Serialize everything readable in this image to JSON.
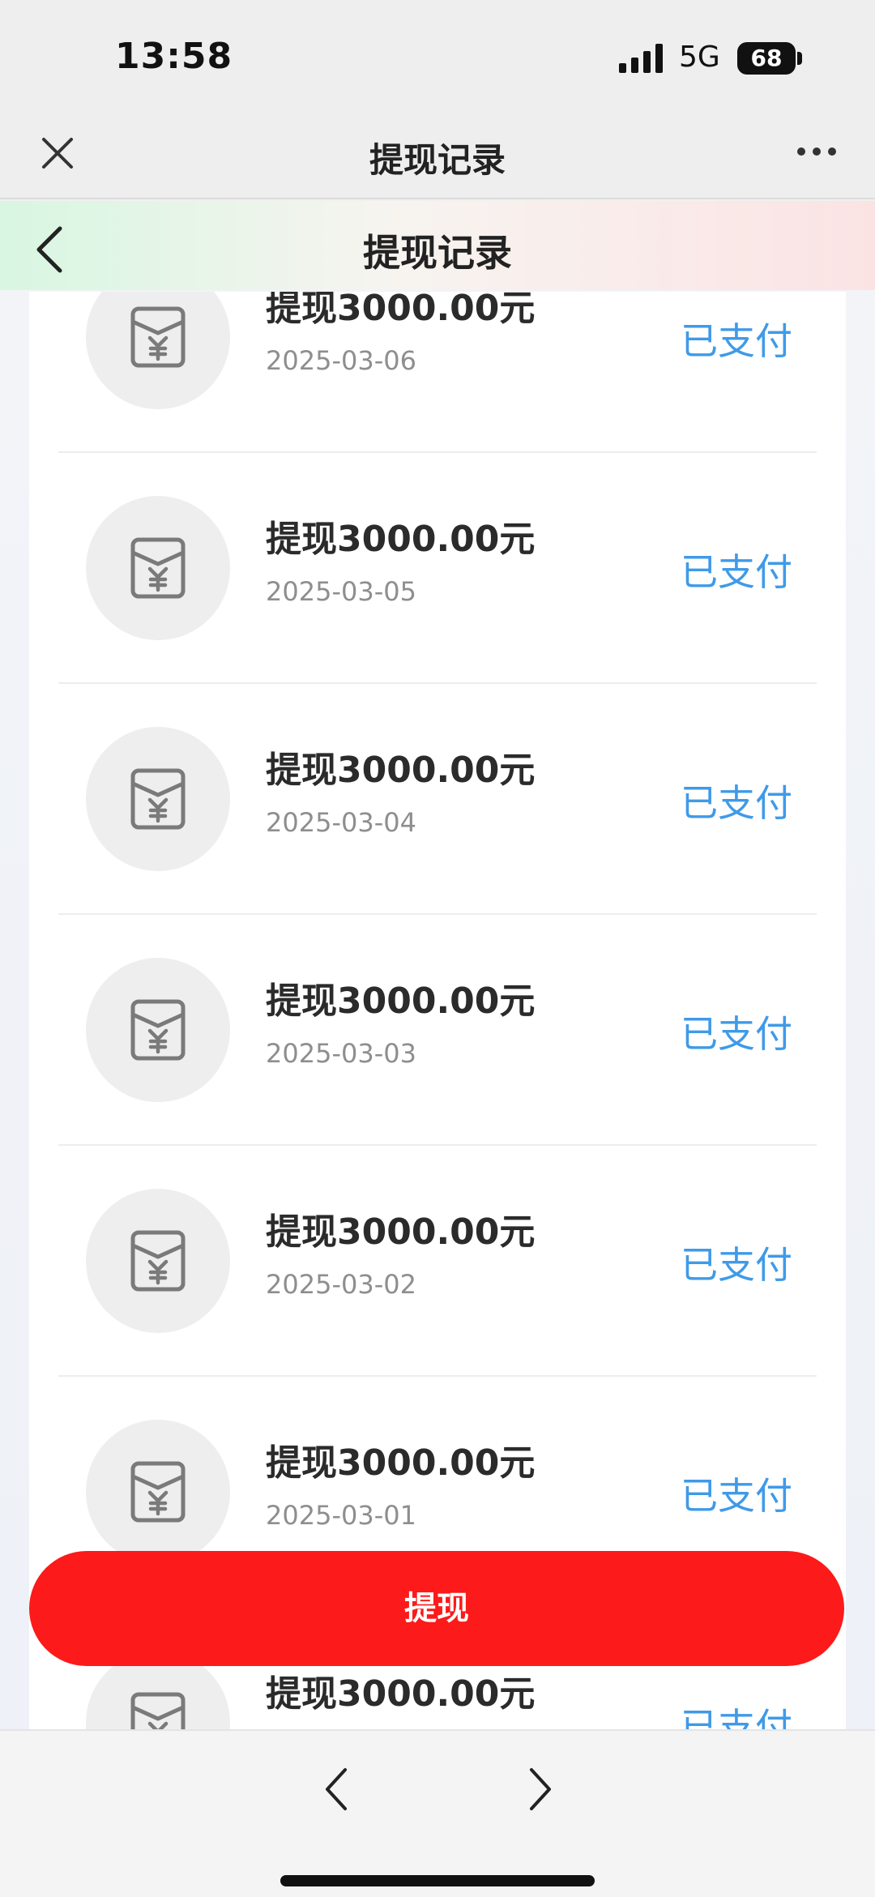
{
  "status_bar": {
    "time": "13:58",
    "network": "5G",
    "battery": "68"
  },
  "browser": {
    "title": "提现记录"
  },
  "page": {
    "title": "提现记录"
  },
  "records": [
    {
      "title": "提现3000.00元",
      "date": "2025-03-06",
      "status": "已支付"
    },
    {
      "title": "提现3000.00元",
      "date": "2025-03-05",
      "status": "已支付"
    },
    {
      "title": "提现3000.00元",
      "date": "2025-03-04",
      "status": "已支付"
    },
    {
      "title": "提现3000.00元",
      "date": "2025-03-03",
      "status": "已支付"
    },
    {
      "title": "提现3000.00元",
      "date": "2025-03-02",
      "status": "已支付"
    },
    {
      "title": "提现3000.00元",
      "date": "2025-03-01",
      "status": "已支付"
    },
    {
      "title": "提现3000.00元",
      "date": "",
      "status": "已支付"
    }
  ],
  "withdraw_button": {
    "label": "提现"
  },
  "icons": {
    "close": "close-icon",
    "more": "more-icon",
    "back": "chevron-left-icon",
    "record": "red-envelope-yuan-icon",
    "nav_back": "chevron-left-icon",
    "nav_forward": "chevron-right-icon"
  },
  "colors": {
    "accent": "#fc1a1a",
    "status": "#3f9ae8",
    "title": "#2b2b2b",
    "date": "#8e8e8e"
  }
}
